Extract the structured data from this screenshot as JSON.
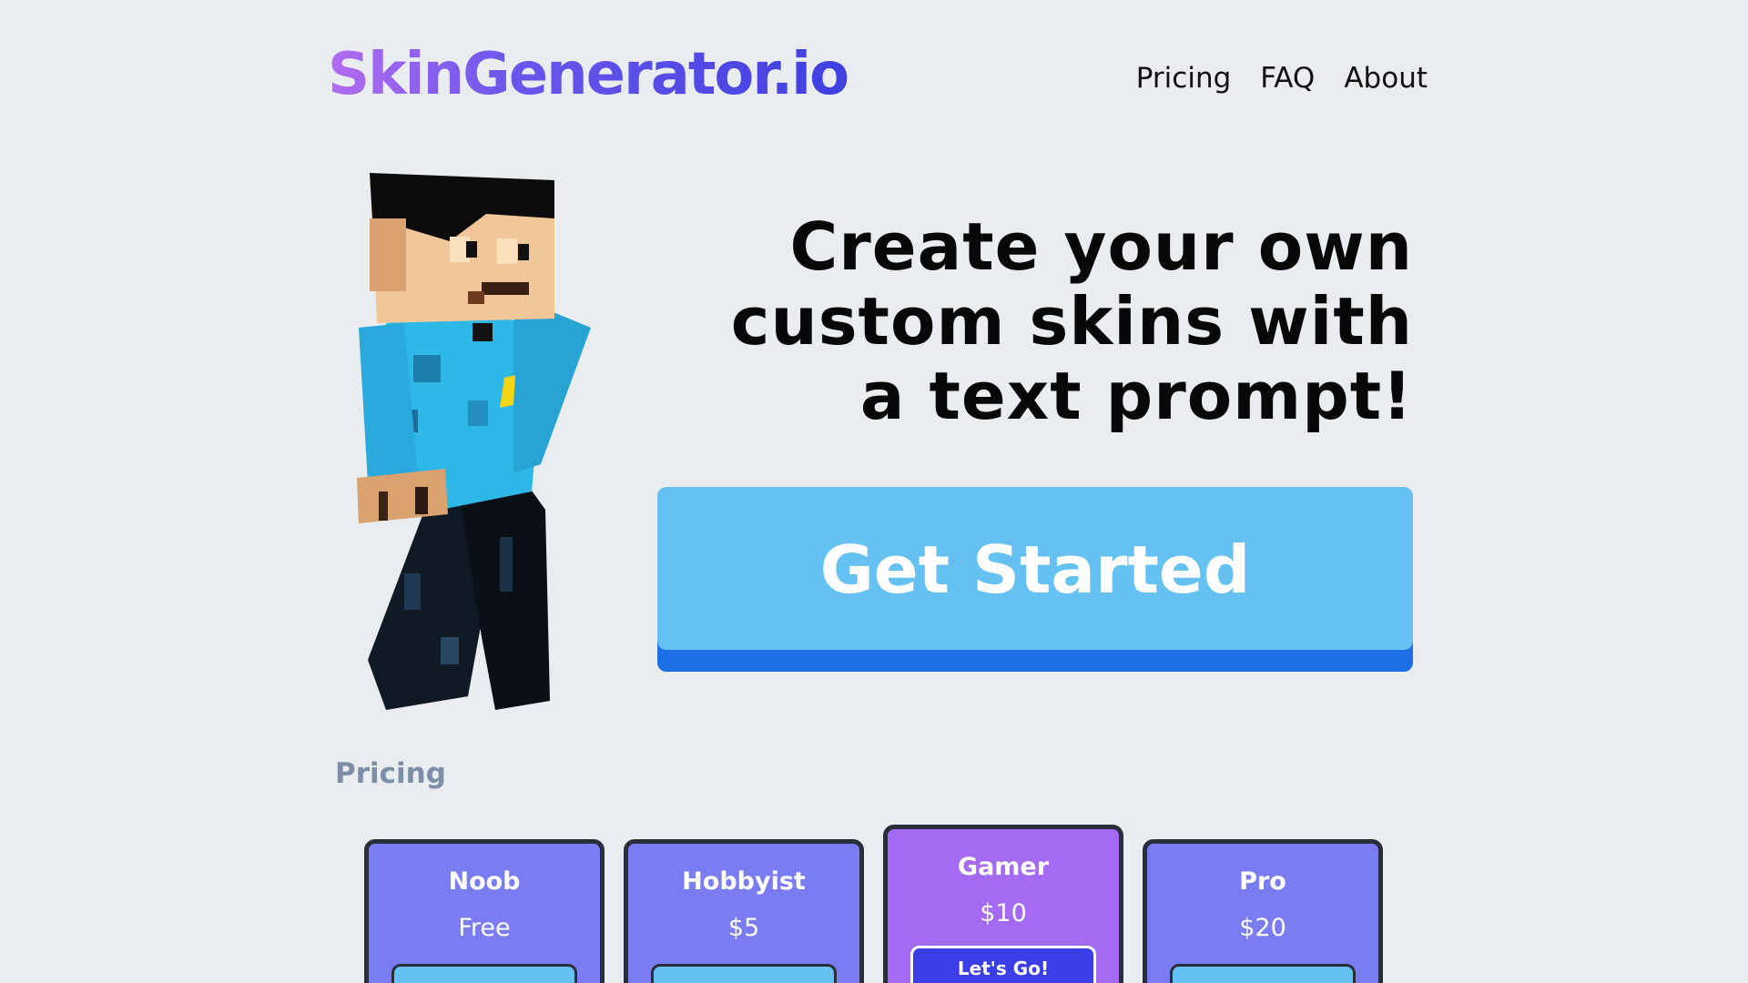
{
  "logo": {
    "text": "SkinGenerator.io"
  },
  "nav": {
    "items": [
      "Pricing",
      "FAQ",
      "About"
    ]
  },
  "hero": {
    "headline": "Create your own custom skins with a text prompt!",
    "cta_label": "Get Started"
  },
  "pricing": {
    "title": "Pricing",
    "plans": [
      {
        "name": "Noob",
        "price": "Free",
        "button": ""
      },
      {
        "name": "Hobbyist",
        "price": "$5",
        "button": ""
      },
      {
        "name": "Gamer",
        "price": "$10",
        "button": "Let's Go!"
      },
      {
        "name": "Pro",
        "price": "$20",
        "button": ""
      }
    ]
  },
  "colors": {
    "background": "#e9edf0",
    "accent_blue": "#66c1f3",
    "accent_shadow": "#1e6fe6",
    "plan_purple": "#7a7cf2",
    "featured_purple": "#a46af2",
    "featured_button": "#3b3ee6"
  }
}
